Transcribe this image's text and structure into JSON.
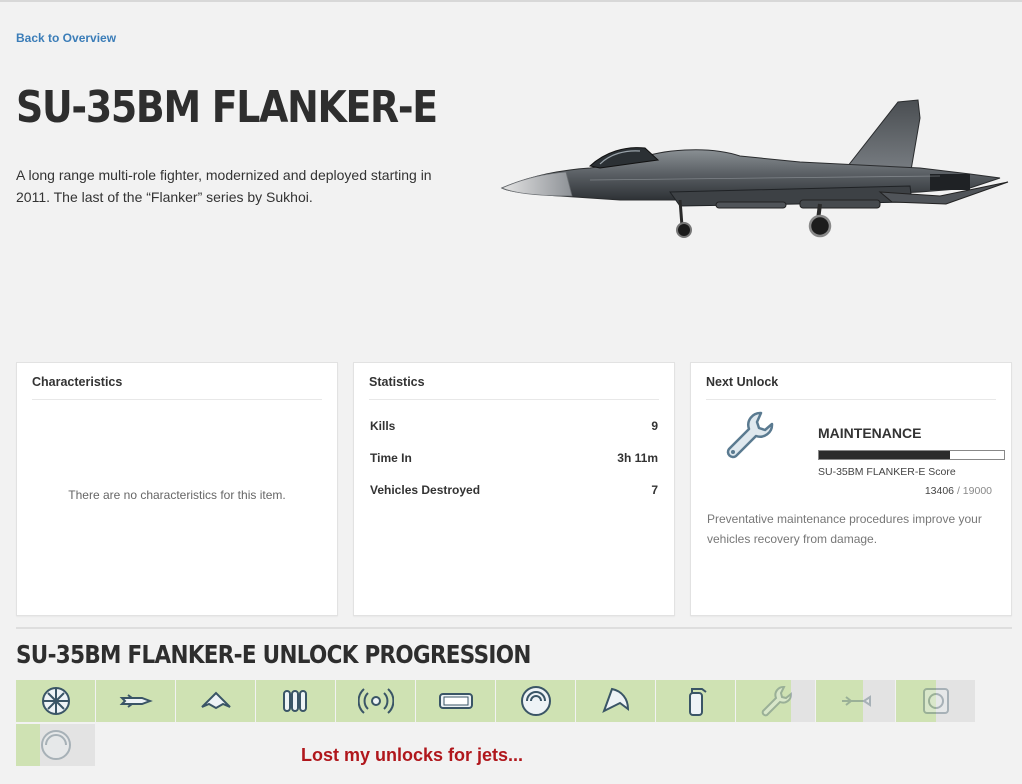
{
  "nav": {
    "back_label": "Back to Overview"
  },
  "vehicle": {
    "name": "SU-35BM FLANKER-E",
    "description": "A long range multi-role fighter, modernized and deployed starting in 2011. The last of the “Flanker” series by Sukhoi."
  },
  "characteristics": {
    "title": "Characteristics",
    "empty_text": "There are no characteristics for this item."
  },
  "statistics": {
    "title": "Statistics",
    "rows": [
      {
        "label": "Kills",
        "value": "9"
      },
      {
        "label": "Time In",
        "value": "3h 11m"
      },
      {
        "label": "Vehicles Destroyed",
        "value": "7"
      }
    ]
  },
  "next_unlock": {
    "title": "Next Unlock",
    "icon": "wrench-icon",
    "name": "MAINTENANCE",
    "source": "SU-35BM FLANKER-E Score",
    "current": "13406",
    "separator": "/",
    "required": "19000",
    "progress_fraction": 0.706,
    "description": "Preventative maintenance procedures improve your vehicles recovery from damage."
  },
  "progression": {
    "title": "SU-35BM FLANKER-E UNLOCK PROGRESSION",
    "tiles": [
      {
        "icon": "flare-icon",
        "unlocked_fraction": 1
      },
      {
        "icon": "guided-missile-icon",
        "unlocked_fraction": 1
      },
      {
        "icon": "stealth-icon",
        "unlocked_fraction": 1
      },
      {
        "icon": "rocket-pods-icon",
        "unlocked_fraction": 1
      },
      {
        "icon": "ecm-jammer-icon",
        "unlocked_fraction": 1
      },
      {
        "icon": "air-radar-icon",
        "unlocked_fraction": 1
      },
      {
        "icon": "proximity-scan-icon",
        "unlocked_fraction": 1
      },
      {
        "icon": "heat-seeker-icon",
        "unlocked_fraction": 1
      },
      {
        "icon": "extinguisher-icon",
        "unlocked_fraction": 1
      },
      {
        "icon": "wrench-icon",
        "unlocked_fraction": 0.7
      },
      {
        "icon": "radar-missile-icon",
        "unlocked_fraction": 0.6
      },
      {
        "icon": "belt-speed-icon",
        "unlocked_fraction": 0.5
      },
      {
        "icon": "guided-shell-icon",
        "unlocked_fraction": 0.3
      }
    ]
  },
  "annotation": {
    "text": "Lost my unlocks for jets..."
  },
  "colors": {
    "link": "#3b7db8",
    "tile_unlocked": "#cfe2b3",
    "tile_locked": "#e3e3e3",
    "annotation": "#b0171c",
    "progress_fill": "#2b2b2b"
  }
}
